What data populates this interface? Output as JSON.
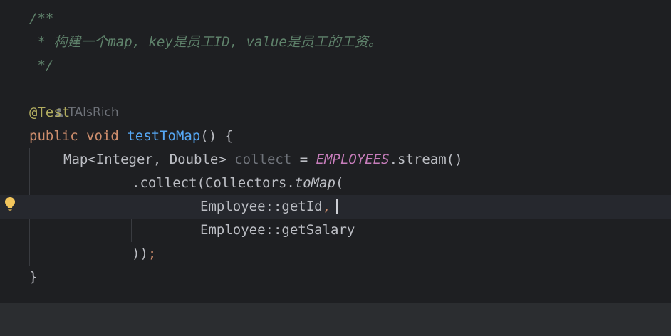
{
  "editor": {
    "comment_open": "/**",
    "comment_body": " * 构建一个map, key是员工ID, value是员工的工资。",
    "comment_close": " */",
    "author": "TAIsRich",
    "annotation": "@Test",
    "kw_public": "public",
    "kw_void": "void",
    "method_name": "testToMap",
    "method_tail": "() {",
    "l1_type": "Map<Integer, Double> ",
    "l1_var": "collect",
    "l1_eq": " = ",
    "l1_const": "EMPLOYEES",
    "l1_call": ".stream()",
    "l2_collect": ".collect(Collectors.",
    "l2_tomap": "toMap",
    "l2_paren": "(",
    "l3_ref": "Employee::getId",
    "l3_comma": ",",
    "l4_ref": "Employee::getSalary",
    "l5_close": "))",
    "l5_semi": ";",
    "closing_brace": "}"
  },
  "colors": {
    "background": "#1e1f22",
    "comment": "#5f826b",
    "keyword": "#cf8e6d",
    "annotation": "#b3ae60",
    "function": "#56a8f5",
    "constant": "#c77dbb",
    "text": "#bcbec4",
    "unused": "#6f737a",
    "bulb": "#f2c55c"
  },
  "icons": {
    "author": "person-icon",
    "intention": "lightbulb-icon"
  }
}
